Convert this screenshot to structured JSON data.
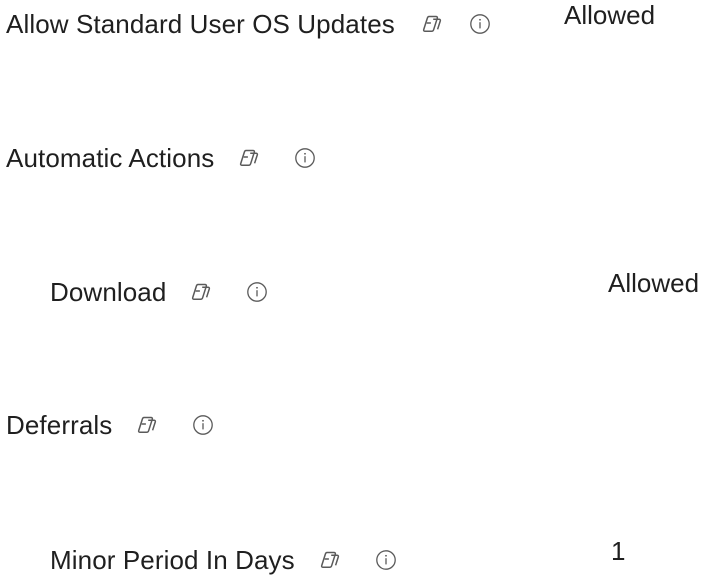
{
  "settings": [
    {
      "label": "Allow Standard User OS Updates",
      "value": "Allowed",
      "icons": [
        "copilot-icon",
        "info-icon"
      ]
    },
    {
      "label": "Automatic Actions",
      "value": "",
      "icons": [
        "copilot-icon",
        "info-icon"
      ]
    },
    {
      "label": "Download",
      "value": "Allowed",
      "icons": [
        "copilot-icon",
        "info-icon"
      ]
    },
    {
      "label": "Deferrals",
      "value": "",
      "icons": [
        "copilot-icon",
        "info-icon"
      ]
    },
    {
      "label": "Minor Period In Days",
      "value": "1",
      "icons": [
        "copilot-icon",
        "info-icon"
      ]
    }
  ],
  "colors": {
    "text": "#1f1f1f",
    "icon": "#5a5a5a",
    "background": "#ffffff"
  }
}
